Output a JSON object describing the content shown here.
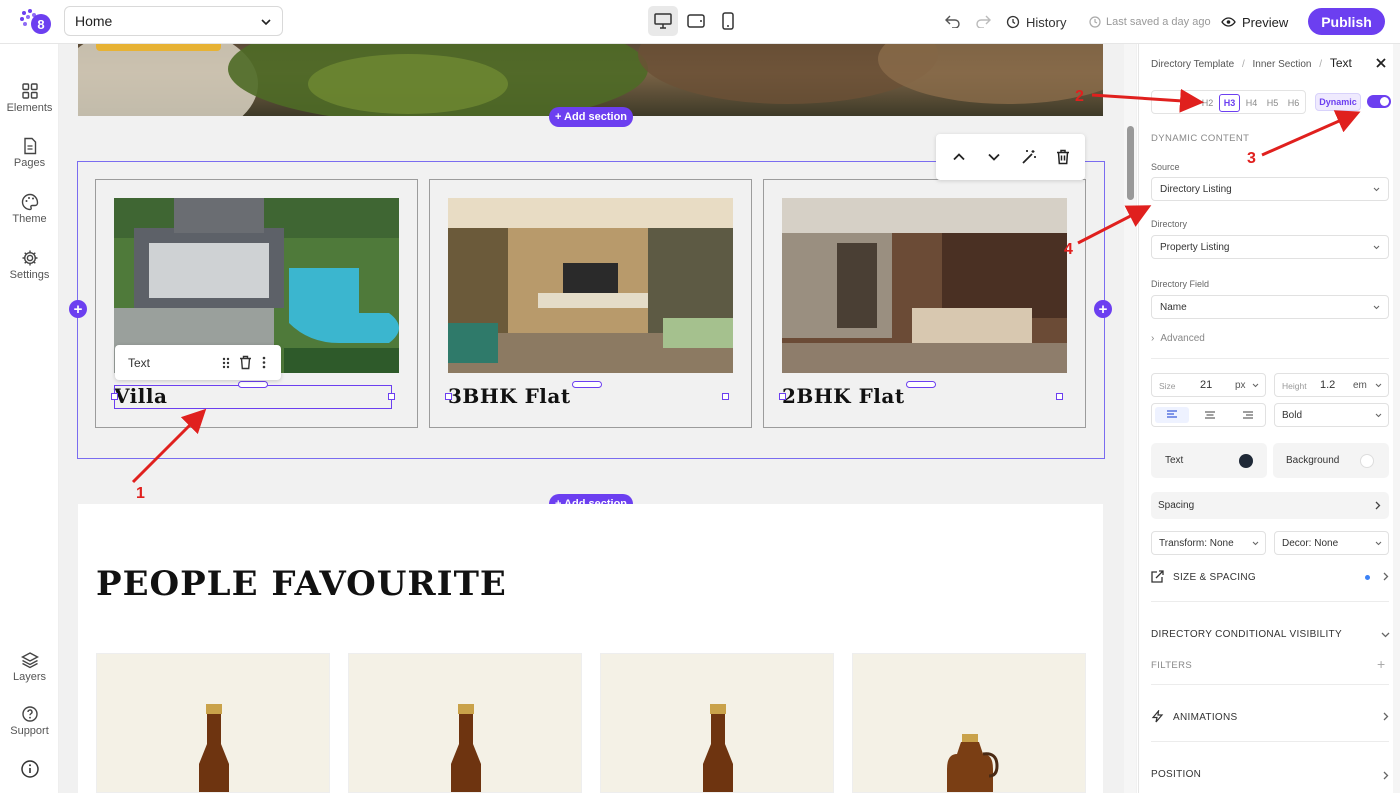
{
  "topbar": {
    "page_select": "Home",
    "history_label": "History",
    "saved_label": "Last saved a day ago",
    "preview_label": "Preview",
    "publish_label": "Publish"
  },
  "leftbar": {
    "items": [
      "Elements",
      "Pages",
      "Theme",
      "Settings"
    ],
    "bottom_items": [
      "Layers",
      "Support"
    ]
  },
  "canvas": {
    "add_section_label": "+ Add section",
    "cards": [
      "Villa",
      "3BHK Flat",
      "2BHK Flat"
    ],
    "text_toolbar_label": "Text",
    "section_heading": "PEOPLE FAVOURITE"
  },
  "panel": {
    "breadcrumb": [
      "Directory Template",
      "Inner Section",
      "Text"
    ],
    "heading_levels": [
      "H2",
      "H3",
      "H4",
      "H5",
      "H6"
    ],
    "active_heading": "H3",
    "dynamic_badge": "Dynamic",
    "dynamic_content_label": "DYNAMIC CONTENT",
    "source_label": "Source",
    "source_value": "Directory Listing",
    "directory_label": "Directory",
    "directory_value": "Property Listing",
    "field_label": "Directory Field",
    "field_value": "Name",
    "advanced_label": "Advanced",
    "size_label": "Size",
    "size_value": "21",
    "size_unit": "px",
    "height_label": "Height",
    "height_value": "1.2",
    "height_unit": "em",
    "weight_value": "Bold",
    "text_color_label": "Text",
    "bg_color_label": "Background",
    "spacing_label": "Spacing",
    "transform_value": "Transform: None",
    "decor_value": "Decor: None",
    "size_spacing_label": "SIZE & SPACING",
    "visibility_label": "DIRECTORY CONDITIONAL VISIBILITY",
    "filters_label": "FILTERS",
    "animations_label": "ANIMATIONS",
    "position_label": "POSITION"
  },
  "annotations": [
    "1",
    "2",
    "3",
    "4"
  ],
  "colors": {
    "accent": "#6c3ff0",
    "annotation": "#e0201e",
    "text_swatch": "#1f2937"
  }
}
